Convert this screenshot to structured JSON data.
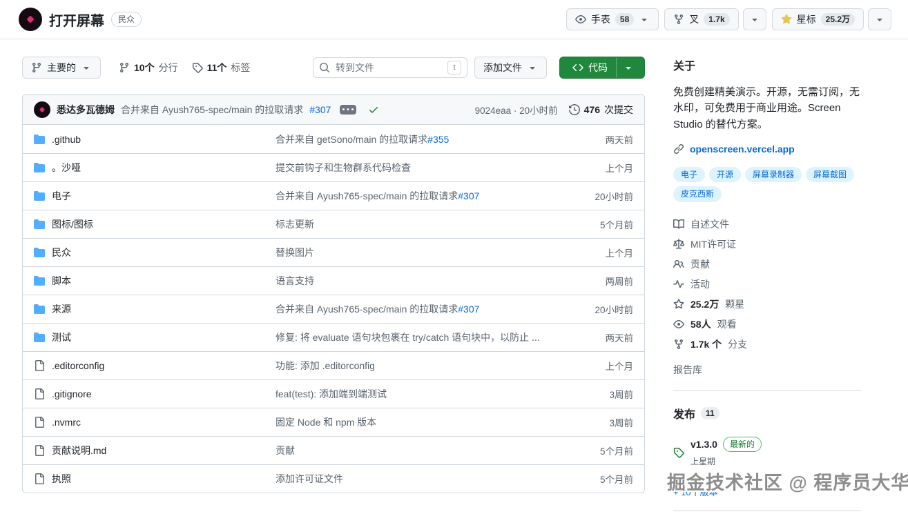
{
  "header": {
    "title": "打开屏幕",
    "visibility_badge": "民众",
    "watch_label": "手表",
    "watch_count": "58",
    "fork_label": "叉",
    "fork_count": "1.7k",
    "star_label": "星标",
    "star_count": "25.2万"
  },
  "toolbar": {
    "branch_button_label": "主要的",
    "branches_count": "10个",
    "branches_label": "分行",
    "tags_count": "11个",
    "tags_label": "标签",
    "search_placeholder": "转到文件",
    "search_key_hint": "t",
    "add_file_label": "添加文件",
    "code_button_label": "代码"
  },
  "commit_bar": {
    "author": "悉达多瓦德姆",
    "message": "合并来自 Ayush765-spec/main 的拉取请求",
    "pr_link": "#307",
    "sha_and_time": "9024eaa · 20小时前",
    "commits_count": "476",
    "commits_label": "次提交"
  },
  "file_table": {
    "rows": [
      {
        "icon": "folder-icon",
        "name": ".github",
        "message": "合并来自 getSono/main 的拉取请求",
        "link": "#355",
        "time": "两天前"
      },
      {
        "icon": "folder-icon",
        "name": "。沙哑",
        "message": "提交前钩子和生物群系代码检查",
        "link": "",
        "time": "上个月"
      },
      {
        "icon": "folder-icon",
        "name": "电子",
        "message": "合并来自 Ayush765-spec/main 的拉取请求",
        "link": "#307",
        "time": "20小时前"
      },
      {
        "icon": "folder-icon",
        "name": "图标/图标",
        "message": "标志更新",
        "link": "",
        "time": "5个月前"
      },
      {
        "icon": "folder-icon",
        "name": "民众",
        "message": "替换图片",
        "link": "",
        "time": "上个月"
      },
      {
        "icon": "folder-icon",
        "name": "脚本",
        "message": "语言支持",
        "link": "",
        "time": "两周前"
      },
      {
        "icon": "folder-icon",
        "name": "来源",
        "message": "合并来自 Ayush765-spec/main 的拉取请求",
        "link": "#307",
        "time": "20小时前"
      },
      {
        "icon": "folder-icon",
        "name": "测试",
        "message": "修复: 将 evaluate 语句块包裹在 try/catch 语句块中，以防止 ...",
        "link": "",
        "time": "两天前"
      },
      {
        "icon": "file-icon",
        "name": ".editorconfig",
        "message": "功能: 添加 .editorconfig",
        "link": "",
        "time": "上个月"
      },
      {
        "icon": "file-icon",
        "name": ".gitignore",
        "message": "feat(test): 添加端到端测试",
        "link": "",
        "time": "3周前"
      },
      {
        "icon": "file-icon",
        "name": ".nvmrc",
        "message": "固定 Node 和 npm 版本",
        "link": "",
        "time": "3周前"
      },
      {
        "icon": "file-icon",
        "name": "贡献说明.md",
        "message": "贡献",
        "link": "",
        "time": "5个月前"
      },
      {
        "icon": "file-icon",
        "name": "执照",
        "message": "添加许可证文件",
        "link": "",
        "time": "5个月前"
      }
    ]
  },
  "sidebar": {
    "about_title": "关于",
    "description": "免费创建精美演示。开源，无需订阅，无水印，可免费用于商业用途。Screen Studio 的替代方案。",
    "website": "openscreen.vercel.app",
    "topics": [
      "电子",
      "开源",
      "屏幕录制器",
      "屏幕截图",
      "皮克西斯"
    ],
    "meta_items": [
      {
        "icon": "book-icon",
        "strong": "",
        "label": "自述文件"
      },
      {
        "icon": "law-icon",
        "strong": "",
        "label": "MIT许可证"
      },
      {
        "icon": "people-icon",
        "strong": "",
        "label": "贡献"
      },
      {
        "icon": "pulse-icon",
        "strong": "",
        "label": "活动"
      },
      {
        "icon": "star-outline-icon",
        "strong": "25.2万",
        "label": "颗星"
      },
      {
        "icon": "eye-icon",
        "strong": "58人",
        "label": "观看"
      },
      {
        "icon": "fork-icon",
        "strong": "1.7k 个",
        "label": "分支"
      }
    ],
    "report_link": "报告库",
    "releases": {
      "title": "发布",
      "count": "11",
      "version": "v1.3.0",
      "latest_badge": "最新的",
      "time": "上星期",
      "more_link": "+ 10个版本"
    }
  },
  "watermark": "掘金技术社区 @ 程序员大华",
  "colors": {
    "accent_blue": "#0969da",
    "folder_blue": "#54aeff",
    "button_green": "#1f883d",
    "star_yellow": "#eac54f",
    "check_green": "#1a7f37",
    "topic_pill_bg": "#ddf4ff",
    "header_bg": "#f6f8fa",
    "border": "#d0d7de"
  }
}
